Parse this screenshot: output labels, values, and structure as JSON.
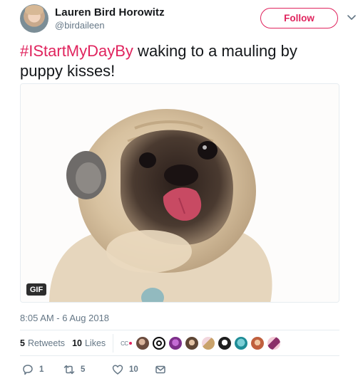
{
  "user": {
    "name": "Lauren Bird Horowitz",
    "handle": "@birdaileen"
  },
  "follow_label": "Follow",
  "tweet": {
    "hashtag": "#IStartMyDayBy",
    "text": " waking to a mauling by puppy kisses!"
  },
  "media": {
    "badge": "GIF"
  },
  "timestamp": "8:05 AM - 6 Aug 2018",
  "stats": {
    "retweets_count": "5",
    "retweets_label": "Retweets",
    "likes_count": "10",
    "likes_label": "Likes"
  },
  "actions": {
    "replies": "1",
    "retweets": "5",
    "likes": "10"
  },
  "icons": [
    "avatar",
    "chevron-down-icon",
    "reply-icon",
    "retweet-icon",
    "heart-icon",
    "message-icon"
  ],
  "colors": {
    "accent": "#e0245e",
    "secondary_text": "#657786",
    "border": "#e6ecf0"
  }
}
